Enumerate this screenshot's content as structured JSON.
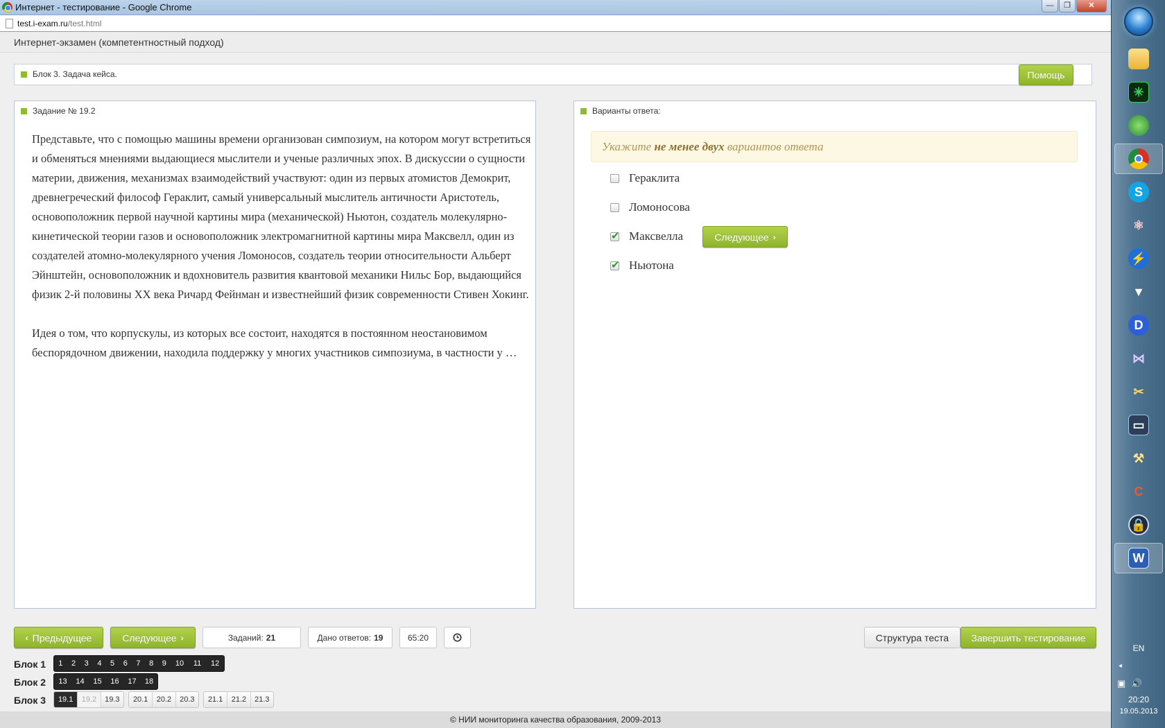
{
  "browser": {
    "title": "Интернет - тестирование - Google Chrome",
    "url_host": "test.i-exam.ru",
    "url_path": "/test.html"
  },
  "app": {
    "title": "Интернет-экзамен (компетентностный подход)"
  },
  "block": {
    "label": "Блок 3. Задача кейса.",
    "help_label": "Помощь"
  },
  "task": {
    "label": "Задание № 19.2",
    "paragraphs": [
      "Представьте, что с помощью машины времени организован симпозиум, на котором могут встретиться и обменяться мнениями выдающиеся мыслители и ученые различных эпох. В дискуссии о сущности материи, движения, механизмах взаимодействий участвуют: один из первых атомистов Демокрит, древнегреческий философ Гераклит, самый универсальный мыслитель античности Аристотель, основоположник первой научной картины мира (механической) Ньютон, создатель молекулярно-кинетической теории газов и основоположник электромагнитной картины мира Максвелл, один из создателей атомно-молекулярного учения Ломоносов, создатель теории относительности Альберт Эйнштейн, основоположник и вдохновитель развития квантовой механики Нильс Бор, выдающийся физик 2-й половины XX века Ричард Фейнман и известнейший физик современности Стивен Хокинг.",
      "Идея о том, что корпускулы, из которых все состоит, находятся в постоянном неостановимом беспорядочном движении, находила поддержку у многих участников симпозиума, в частности у …"
    ]
  },
  "answers": {
    "label": "Варианты ответа:",
    "hint_pre": "Укажите",
    "hint_bold": "не менее двух",
    "hint_post": "вариантов ответа",
    "options": [
      {
        "label": "Гераклита",
        "checked": false
      },
      {
        "label": "Ломоносова",
        "checked": false
      },
      {
        "label": "Максвелла",
        "checked": true
      },
      {
        "label": "Ньютона",
        "checked": true
      }
    ],
    "next_label": "Следующее"
  },
  "toolbar": {
    "prev_label": "Предыдущее",
    "next_label": "Следующее",
    "tasks_label": "Заданий:",
    "tasks_count": "21",
    "answers_label": "Дано ответов:",
    "answers_count": "19",
    "timer": "65:20",
    "timer_icon": "clock-icon",
    "structure_label": "Структура теста",
    "finish_label": "Завершить тестирование"
  },
  "blocks": [
    {
      "label": "Блок 1",
      "groups": [
        {
          "style": "dark",
          "items": [
            "1",
            "2",
            "3",
            "4",
            "5",
            "6",
            "7",
            "8",
            "9",
            "10",
            "11",
            "12"
          ]
        }
      ]
    },
    {
      "label": "Блок 2",
      "groups": [
        {
          "style": "dark",
          "items": [
            "13",
            "14",
            "15",
            "16",
            "17",
            "18"
          ]
        }
      ]
    },
    {
      "label": "Блок 3",
      "groups": [
        {
          "style": "light",
          "items": [
            "19.1",
            "19.2",
            "19.3"
          ]
        },
        {
          "style": "light",
          "items": [
            "20.1",
            "20.2",
            "20.3"
          ]
        },
        {
          "style": "light",
          "items": [
            "21.1",
            "21.2",
            "21.3"
          ]
        }
      ]
    }
  ],
  "footer": {
    "text": "© НИИ мониторинга качества образования, 2009-2013"
  },
  "taskbar": {
    "lang": "EN",
    "time": "20:20",
    "date": "19.05.2013",
    "accent": "#8fbc2a"
  }
}
